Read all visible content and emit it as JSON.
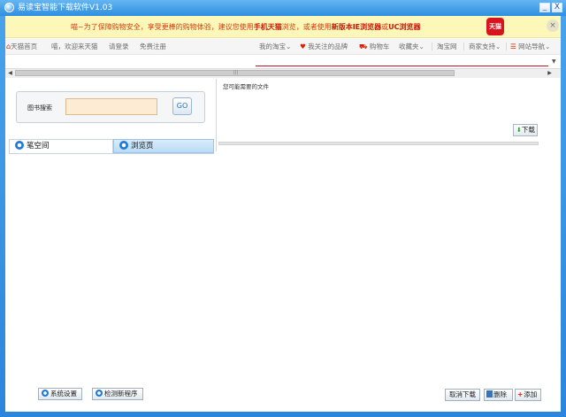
{
  "window": {
    "title": "易读宝智能下载软件V1.03",
    "minimize_glyph": "_",
    "close_glyph": "X"
  },
  "promo": {
    "text_prefix": "喵~为了保障购物安全，享受更棒的购物体验，建议您使用",
    "text_highlight1": "手机天猫",
    "text_mid": "浏览，或者使用",
    "text_highlight2": "新版本IE浏览器",
    "text_or": "或",
    "text_highlight3": "UC浏览器",
    "badge": "天猫",
    "close_glyph": "×"
  },
  "navbar": {
    "home": "天猫首页",
    "greeting": "喵，欢迎来天猫",
    "login": "请登录",
    "register": "免费注册",
    "my_taobao": "我的淘宝",
    "brands": "我关注的品牌",
    "cart": "购物车",
    "favorites": "收藏夹",
    "taobao": "淘宝网",
    "seller": "商家支持",
    "sitenav": "网站导航"
  },
  "search": {
    "label": "图书搜索",
    "value": "",
    "go_label": "GO"
  },
  "file_panel": {
    "header": "您可能需要的文件",
    "download_label": "下载"
  },
  "tabs": [
    {
      "label": "笔空间"
    },
    {
      "label": "浏览页"
    }
  ],
  "bottom": {
    "settings_label": "系统设置",
    "check_label": "检测新程序",
    "cancel_label": "取消下载",
    "delete_label": "删除",
    "add_label": "添加"
  },
  "colors": {
    "frame": "#2a86dc",
    "promo_bg": "#fdf7b9",
    "accent_red": "#d81e06"
  }
}
